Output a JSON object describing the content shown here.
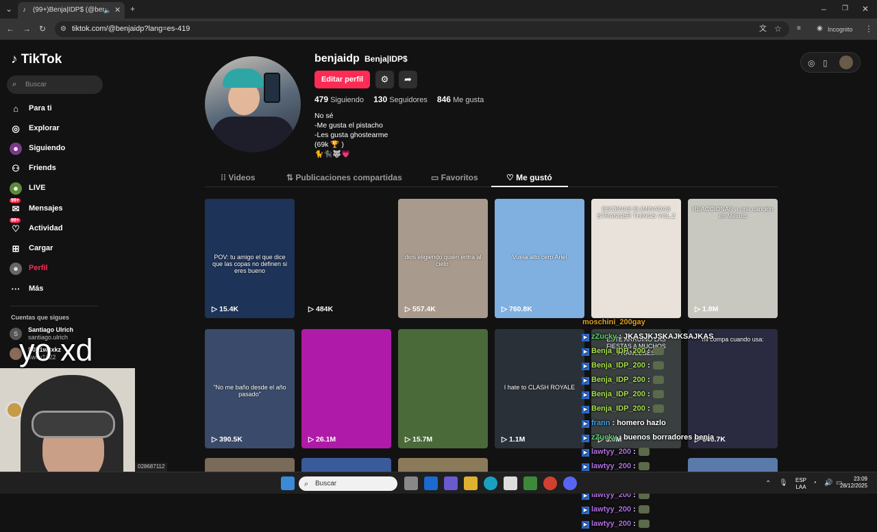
{
  "browser": {
    "tab_title": "(99+)Benja|IDP$ (@benjaidp",
    "url": "tiktok.com/@benjaidp?lang=es-419",
    "incognito_label": "Incognito"
  },
  "sidebar": {
    "logo": "TikTok",
    "search_placeholder": "Buscar",
    "items": [
      {
        "label": "Para ti",
        "icon": "home-icon"
      },
      {
        "label": "Explorar",
        "icon": "compass-icon"
      },
      {
        "label": "Siguiendo",
        "icon": "following-icon"
      },
      {
        "label": "Friends",
        "icon": "friends-icon"
      },
      {
        "label": "LIVE",
        "icon": "live-icon"
      },
      {
        "label": "Mensajes",
        "icon": "messages-icon",
        "badge": "99+"
      },
      {
        "label": "Actividad",
        "icon": "activity-icon",
        "badge": "99+"
      },
      {
        "label": "Cargar",
        "icon": "upload-icon"
      },
      {
        "label": "Perfil",
        "icon": "profile-icon"
      },
      {
        "label": "Más",
        "icon": "more-icon"
      }
    ],
    "following_heading": "Cuentas que sigues",
    "following": [
      {
        "name": "Santiago Ulrich",
        "handle": "santiago.ulrich",
        "initial": "S"
      },
      {
        "name": "S0F1w3xkz",
        "handle": "swrw1922",
        "initial": ""
      }
    ]
  },
  "profile": {
    "username": "benjaidp",
    "nickname": "Benja|IDP$",
    "edit_button": "Editar perfil",
    "following_count": "479",
    "following_label": "Siguiendo",
    "followers_count": "130",
    "followers_label": "Seguidores",
    "likes_count": "846",
    "likes_label": "Me gusta",
    "bio": "No sé\n-Me gusta el pistacho\n-Les gusta ghostearme\n(69k 🏆 )\n🐈🐈‍⬛🐺💗"
  },
  "tabs": [
    {
      "label": "Videos",
      "icon": "grid-icon"
    },
    {
      "label": "Publicaciones compartidas",
      "icon": "repost-icon"
    },
    {
      "label": "Favoritos",
      "icon": "bookmark-icon"
    },
    {
      "label": "Me gustó",
      "icon": "heart-icon"
    }
  ],
  "videos": [
    {
      "views": "15.4K",
      "caption": "POV: tu amigo el que dice que las copas no definen si eres bueno",
      "color": "#1d3358"
    },
    {
      "views": "484K",
      "caption": "",
      "color": "#121212"
    },
    {
      "views": "557.4K",
      "caption": "dios eligiendo quién entra al cielo:",
      "color": "#a89a8c"
    },
    {
      "views": "760.8K",
      "caption": "Vuela alto cero Ariel",
      "color": "#7fb0e0"
    },
    {
      "views": "",
      "caption": "ESCENAS ELIMINADAS STRANGER THINGS VOL.2",
      "color": "#e8e2da"
    },
    {
      "views": "1.8M",
      "caption": "REACCIONAR a una canción en México",
      "color": "#c8c8c0"
    },
    {
      "views": "390.5K",
      "caption": "\"No me baño desde el año pasado\"",
      "color": "#3a4a6a"
    },
    {
      "views": "26.1M",
      "caption": "",
      "color": "#b01aa8"
    },
    {
      "views": "15.7M",
      "caption": "",
      "color": "#4a6a3a"
    },
    {
      "views": "1.1M",
      "caption": "I hate to CLASH ROYALE",
      "color": "#2a3038"
    },
    {
      "views": "3.6M",
      "caption": "ESTE ARRUINÓ LAS FIESTAS A MUCHOS FRANCESES",
      "color": "#3a4040"
    },
    {
      "views": "646.7K",
      "caption": "mi compa cuando usa:",
      "color": "#2a2a40"
    }
  ],
  "chat": [
    {
      "user": "moschini_200gay",
      "text": "",
      "color": "#e0a020"
    },
    {
      "user": "zZucky",
      "text": ": JKASJKJSKAJKSAJKAS",
      "color": "#5ad06a"
    },
    {
      "user": "Benja_IDP_200",
      "text": ":",
      "color": "#a8e050"
    },
    {
      "user": "Benja_IDP_200",
      "text": ":",
      "color": "#a8e050"
    },
    {
      "user": "Benja_IDP_200",
      "text": ":",
      "color": "#a8e050"
    },
    {
      "user": "Benja_IDP_200",
      "text": ":",
      "color": "#a8e050"
    },
    {
      "user": "Benja_IDP_200",
      "text": ":",
      "color": "#a8e050"
    },
    {
      "user": "frann",
      "text": ": homero hazlo",
      "color": "#40a0e0"
    },
    {
      "user": "zZucky",
      "text": ": buenos borradores benja",
      "color": "#5ad06a"
    },
    {
      "user": "lawtyy_200",
      "text": ":",
      "color": "#b070e0"
    },
    {
      "user": "lawtyy_200",
      "text": ":",
      "color": "#b070e0"
    },
    {
      "user": "lawtyy_200",
      "text": ":",
      "color": "#b070e0"
    },
    {
      "user": "lawtyy_200",
      "text": ":",
      "color": "#b070e0"
    },
    {
      "user": "lawtyy_200",
      "text": ":",
      "color": "#b070e0"
    },
    {
      "user": "lawtyy_200",
      "text": ":",
      "color": "#b070e0"
    }
  ],
  "overlay_text": "yo xd",
  "status_bar_url": "028687112",
  "taskbar": {
    "search_placeholder": "Buscar",
    "lang": "ESP",
    "lang2": "LAA",
    "time": "23:09",
    "date": "28/12/2025"
  }
}
